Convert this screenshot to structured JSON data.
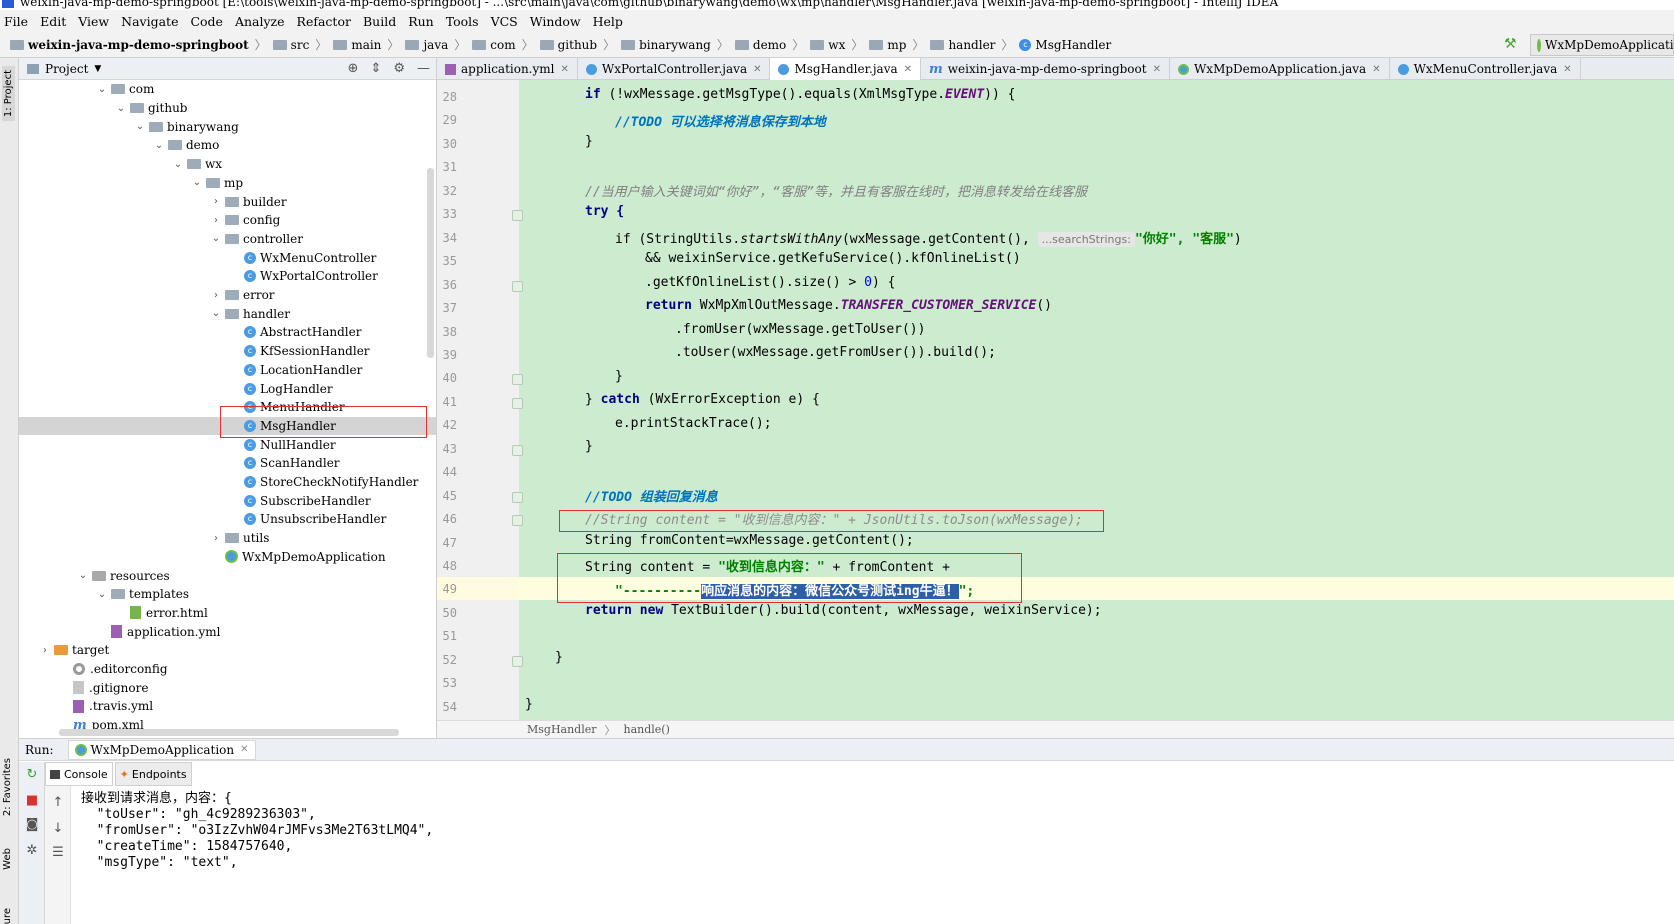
{
  "window": {
    "title": "weixin-java-mp-demo-springboot [E:\\tools\\weixin-java-mp-demo-springboot] - ...\\src\\main\\java\\com\\github\\binarywang\\demo\\wx\\mp\\handler\\MsgHandler.java [weixin-java-mp-demo-springboot] - IntelliJ IDEA"
  },
  "menu": [
    "File",
    "Edit",
    "View",
    "Navigate",
    "Code",
    "Analyze",
    "Refactor",
    "Build",
    "Run",
    "Tools",
    "VCS",
    "Window",
    "Help"
  ],
  "breadcrumbs": [
    "weixin-java-mp-demo-springboot",
    "src",
    "main",
    "java",
    "com",
    "github",
    "binarywang",
    "demo",
    "wx",
    "mp",
    "handler",
    "MsgHandler"
  ],
  "run_config": "WxMpDemoApplication",
  "left_strip": {
    "project": "1: Project",
    "favorites": "2: Favorites",
    "web": "Web",
    "structure": "ure"
  },
  "project_panel": {
    "title": "Project",
    "tree": [
      {
        "label": "com",
        "depth": 0,
        "type": "folder",
        "open": true
      },
      {
        "label": "github",
        "depth": 1,
        "type": "folder",
        "open": true
      },
      {
        "label": "binarywang",
        "depth": 2,
        "type": "folder",
        "open": true
      },
      {
        "label": "demo",
        "depth": 3,
        "type": "folder",
        "open": true
      },
      {
        "label": "wx",
        "depth": 4,
        "type": "folder",
        "open": true
      },
      {
        "label": "mp",
        "depth": 5,
        "type": "folder",
        "open": true
      },
      {
        "label": "builder",
        "depth": 6,
        "type": "folder",
        "open": false
      },
      {
        "label": "config",
        "depth": 6,
        "type": "folder",
        "open": false
      },
      {
        "label": "controller",
        "depth": 6,
        "type": "folder",
        "open": true
      },
      {
        "label": "WxMenuController",
        "depth": 7,
        "type": "class"
      },
      {
        "label": "WxPortalController",
        "depth": 7,
        "type": "class"
      },
      {
        "label": "error",
        "depth": 6,
        "type": "folder",
        "open": false
      },
      {
        "label": "handler",
        "depth": 6,
        "type": "folder",
        "open": true
      },
      {
        "label": "AbstractHandler",
        "depth": 7,
        "type": "class"
      },
      {
        "label": "KfSessionHandler",
        "depth": 7,
        "type": "class"
      },
      {
        "label": "LocationHandler",
        "depth": 7,
        "type": "class"
      },
      {
        "label": "LogHandler",
        "depth": 7,
        "type": "class"
      },
      {
        "label": "MenuHandler",
        "depth": 7,
        "type": "class"
      },
      {
        "label": "MsgHandler",
        "depth": 7,
        "type": "class",
        "selected": true
      },
      {
        "label": "NullHandler",
        "depth": 7,
        "type": "class"
      },
      {
        "label": "ScanHandler",
        "depth": 7,
        "type": "class"
      },
      {
        "label": "StoreCheckNotifyHandler",
        "depth": 7,
        "type": "class"
      },
      {
        "label": "SubscribeHandler",
        "depth": 7,
        "type": "class"
      },
      {
        "label": "UnsubscribeHandler",
        "depth": 7,
        "type": "class"
      },
      {
        "label": "utils",
        "depth": 6,
        "type": "folder",
        "open": false
      },
      {
        "label": "WxMpDemoApplication",
        "depth": 6,
        "type": "app"
      },
      {
        "label": "resources",
        "depth": -1,
        "type": "res",
        "open": true
      },
      {
        "label": "templates",
        "depth": 0,
        "type": "folder",
        "open": true
      },
      {
        "label": "error.html",
        "depth": 1,
        "type": "html"
      },
      {
        "label": "application.yml",
        "depth": 0,
        "type": "yml"
      },
      {
        "label": "target",
        "depth": -3,
        "type": "orange",
        "open": false
      },
      {
        "label": ".editorconfig",
        "depth": -2,
        "type": "gear"
      },
      {
        "label": ".gitignore",
        "depth": -2,
        "type": "file"
      },
      {
        "label": ".travis.yml",
        "depth": -2,
        "type": "yml"
      },
      {
        "label": "pom.xml",
        "depth": -2,
        "type": "m"
      }
    ]
  },
  "tabs": [
    {
      "label": "application.yml",
      "icon": "yml"
    },
    {
      "label": "WxPortalController.java",
      "icon": "class"
    },
    {
      "label": "MsgHandler.java",
      "icon": "class",
      "active": true
    },
    {
      "label": "weixin-java-mp-demo-springboot",
      "icon": "m"
    },
    {
      "label": "WxMpDemoApplication.java",
      "icon": "app"
    },
    {
      "label": "WxMenuController.java",
      "icon": "class"
    }
  ],
  "editor": {
    "line_numbers": [
      "28",
      "29",
      "30",
      "31",
      "32",
      "33",
      "34",
      "35",
      "36",
      "37",
      "38",
      "39",
      "40",
      "41",
      "42",
      "43",
      "44",
      "45",
      "46",
      "47",
      "48",
      "49",
      "50",
      "51",
      "52",
      "53",
      "54"
    ],
    "code": {
      "l28a": "if (!wxMessage.getMsgType().equals(XmlMsgType.",
      "l28b": "EVENT",
      "l28c": ")) {",
      "l29a": "//",
      "l29b": "TODO 可以选择将消息保存到本地",
      "l30": "}",
      "l32": "//当用户输入关键词如“你好”，“客服”等，并且有客服在线时，把消息转发给在线客服",
      "l33": "try {",
      "l34a": "if (StringUtils.",
      "l34b": "startsWithAny",
      "l34c": "(wxMessage.getContent(),",
      "l34hint": "...searchStrings:",
      "l34d": "\"你好\", \"客服\"",
      "l34e": ")",
      "l35": "&& weixinService.getKefuService().kfOnlineList()",
      "l36a": ".getKfOnlineList().size() > ",
      "l36b": "0",
      "l36c": ") {",
      "l37a": "return",
      "l37b": " WxMpXmlOutMessage.",
      "l37c": "TRANSFER_CUSTOMER_SERVICE",
      "l37d": "()",
      "l38": ".fromUser(wxMessage.getToUser())",
      "l39": ".toUser(wxMessage.getFromUser()).build();",
      "l40": "}",
      "l41a": "} ",
      "l41b": "catch",
      "l41c": " (WxErrorException e) {",
      "l42": "e.printStackTrace();",
      "l43": "}",
      "l45a": "//",
      "l45b": "TODO 组装回复消息",
      "l46": "//String content = \"收到信息内容：\" + JsonUtils.toJson(wxMessage);",
      "l47": "String fromContent=wxMessage.getContent();",
      "l48a": "String content = ",
      "l48b": "\"收到信息内容：\"",
      "l48c": " + fromContent +",
      "l49a": "\"----------",
      "l49b": "响应消息的内容：微信公众号测试ing牛逼！",
      "l49c": "\";",
      "l50a": "return new",
      "l50b": " TextBuilder().build(content, wxMessage, weixinService);",
      "l52": "}",
      "l54": "}"
    },
    "breadcrumb": [
      "MsgHandler",
      "handle()"
    ]
  },
  "run_panel": {
    "label": "Run:",
    "tab": "WxMpDemoApplication",
    "subtabs": [
      "Console",
      "Endpoints"
    ],
    "console_lines": [
      "接收到请求消息，内容：{",
      "  \"toUser\": \"gh_4c9289236303\",",
      "  \"fromUser\": \"o3IzZvhW04rJMFvs3Me2T63tLMQ4\",",
      "  \"createTime\": 1584757640,",
      "  \"msgType\": \"text\","
    ]
  }
}
